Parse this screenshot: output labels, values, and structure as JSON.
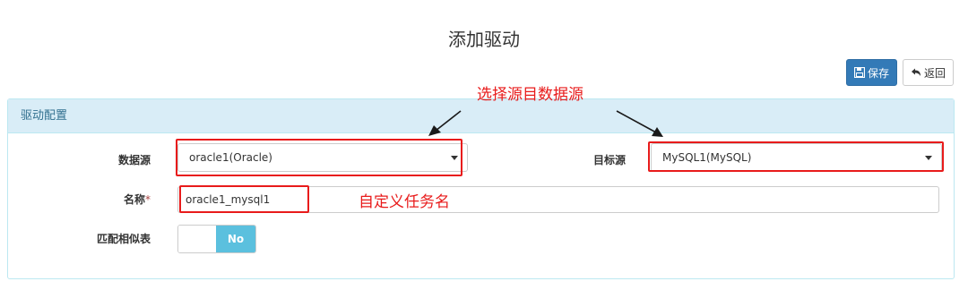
{
  "page": {
    "title": "添加驱动"
  },
  "toolbar": {
    "save_label": "保存",
    "back_label": "返回"
  },
  "panel": {
    "title": "驱动配置"
  },
  "form": {
    "source": {
      "label": "数据源",
      "value": "oracle1(Oracle)"
    },
    "target": {
      "label": "目标源",
      "value": "MySQL1(MySQL)"
    },
    "name": {
      "label": "名称",
      "required_mark": "*",
      "value": "oracle1_mysql1"
    },
    "match": {
      "label": "匹配相似表",
      "toggle_label": "No"
    }
  },
  "annotations": {
    "select_source_target": "选择源目数据源",
    "custom_task_name": "自定义任务名"
  },
  "colors": {
    "primary": "#337ab7",
    "panel_heading_bg": "#d9edf7",
    "toggle_on": "#5bc0de",
    "annotation_red": "#e81b1b"
  },
  "icons": {
    "save": "floppy-disk-icon",
    "back": "back-arrow-icon",
    "dropdown": "caret-down-icon"
  }
}
